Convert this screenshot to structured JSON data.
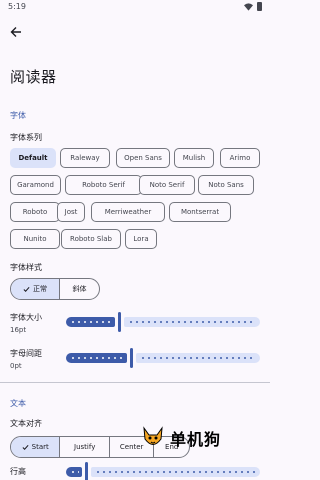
{
  "status": {
    "time": "5:19"
  },
  "header": {
    "title": "阅读器"
  },
  "typography": {
    "section_label": "字体",
    "font_family_label": "字体系列",
    "fonts": [
      "Default",
      "Raleway",
      "Open Sans",
      "Mulish",
      "Arimo",
      "Garamond",
      "Roboto Serif",
      "Noto Serif",
      "Noto Sans",
      "Roboto",
      "Jost",
      "Merriweather",
      "Montserrat",
      "Nunito",
      "Roboto Slab",
      "Lora"
    ],
    "selected_font": "Default",
    "font_style_label": "字体样式",
    "style_options": [
      "正常",
      "斜体"
    ],
    "selected_style": "正常",
    "font_size_label": "字体大小",
    "font_size_value": "16pt",
    "font_size_fraction": 0.27,
    "letter_spacing_label": "字母间距",
    "letter_spacing_value": "0pt",
    "letter_spacing_fraction": 0.33
  },
  "text": {
    "section_label": "文本",
    "alignment_label": "文本对齐",
    "align_options": [
      "Start",
      "Justify",
      "Center",
      "End"
    ],
    "selected_align": "Start",
    "line_height_label": "行高",
    "line_height_fraction": 0.1
  },
  "watermark": {
    "text": "单机狗"
  },
  "colors": {
    "accent": "#3d5ba9",
    "selected_bg": "#dbe2f9",
    "outline": "#75777f",
    "background": "#fbf8fd"
  },
  "icons": {
    "back": "arrow-back-icon",
    "check": "check-icon",
    "wifi": "wifi-icon",
    "battery": "battery-icon"
  }
}
